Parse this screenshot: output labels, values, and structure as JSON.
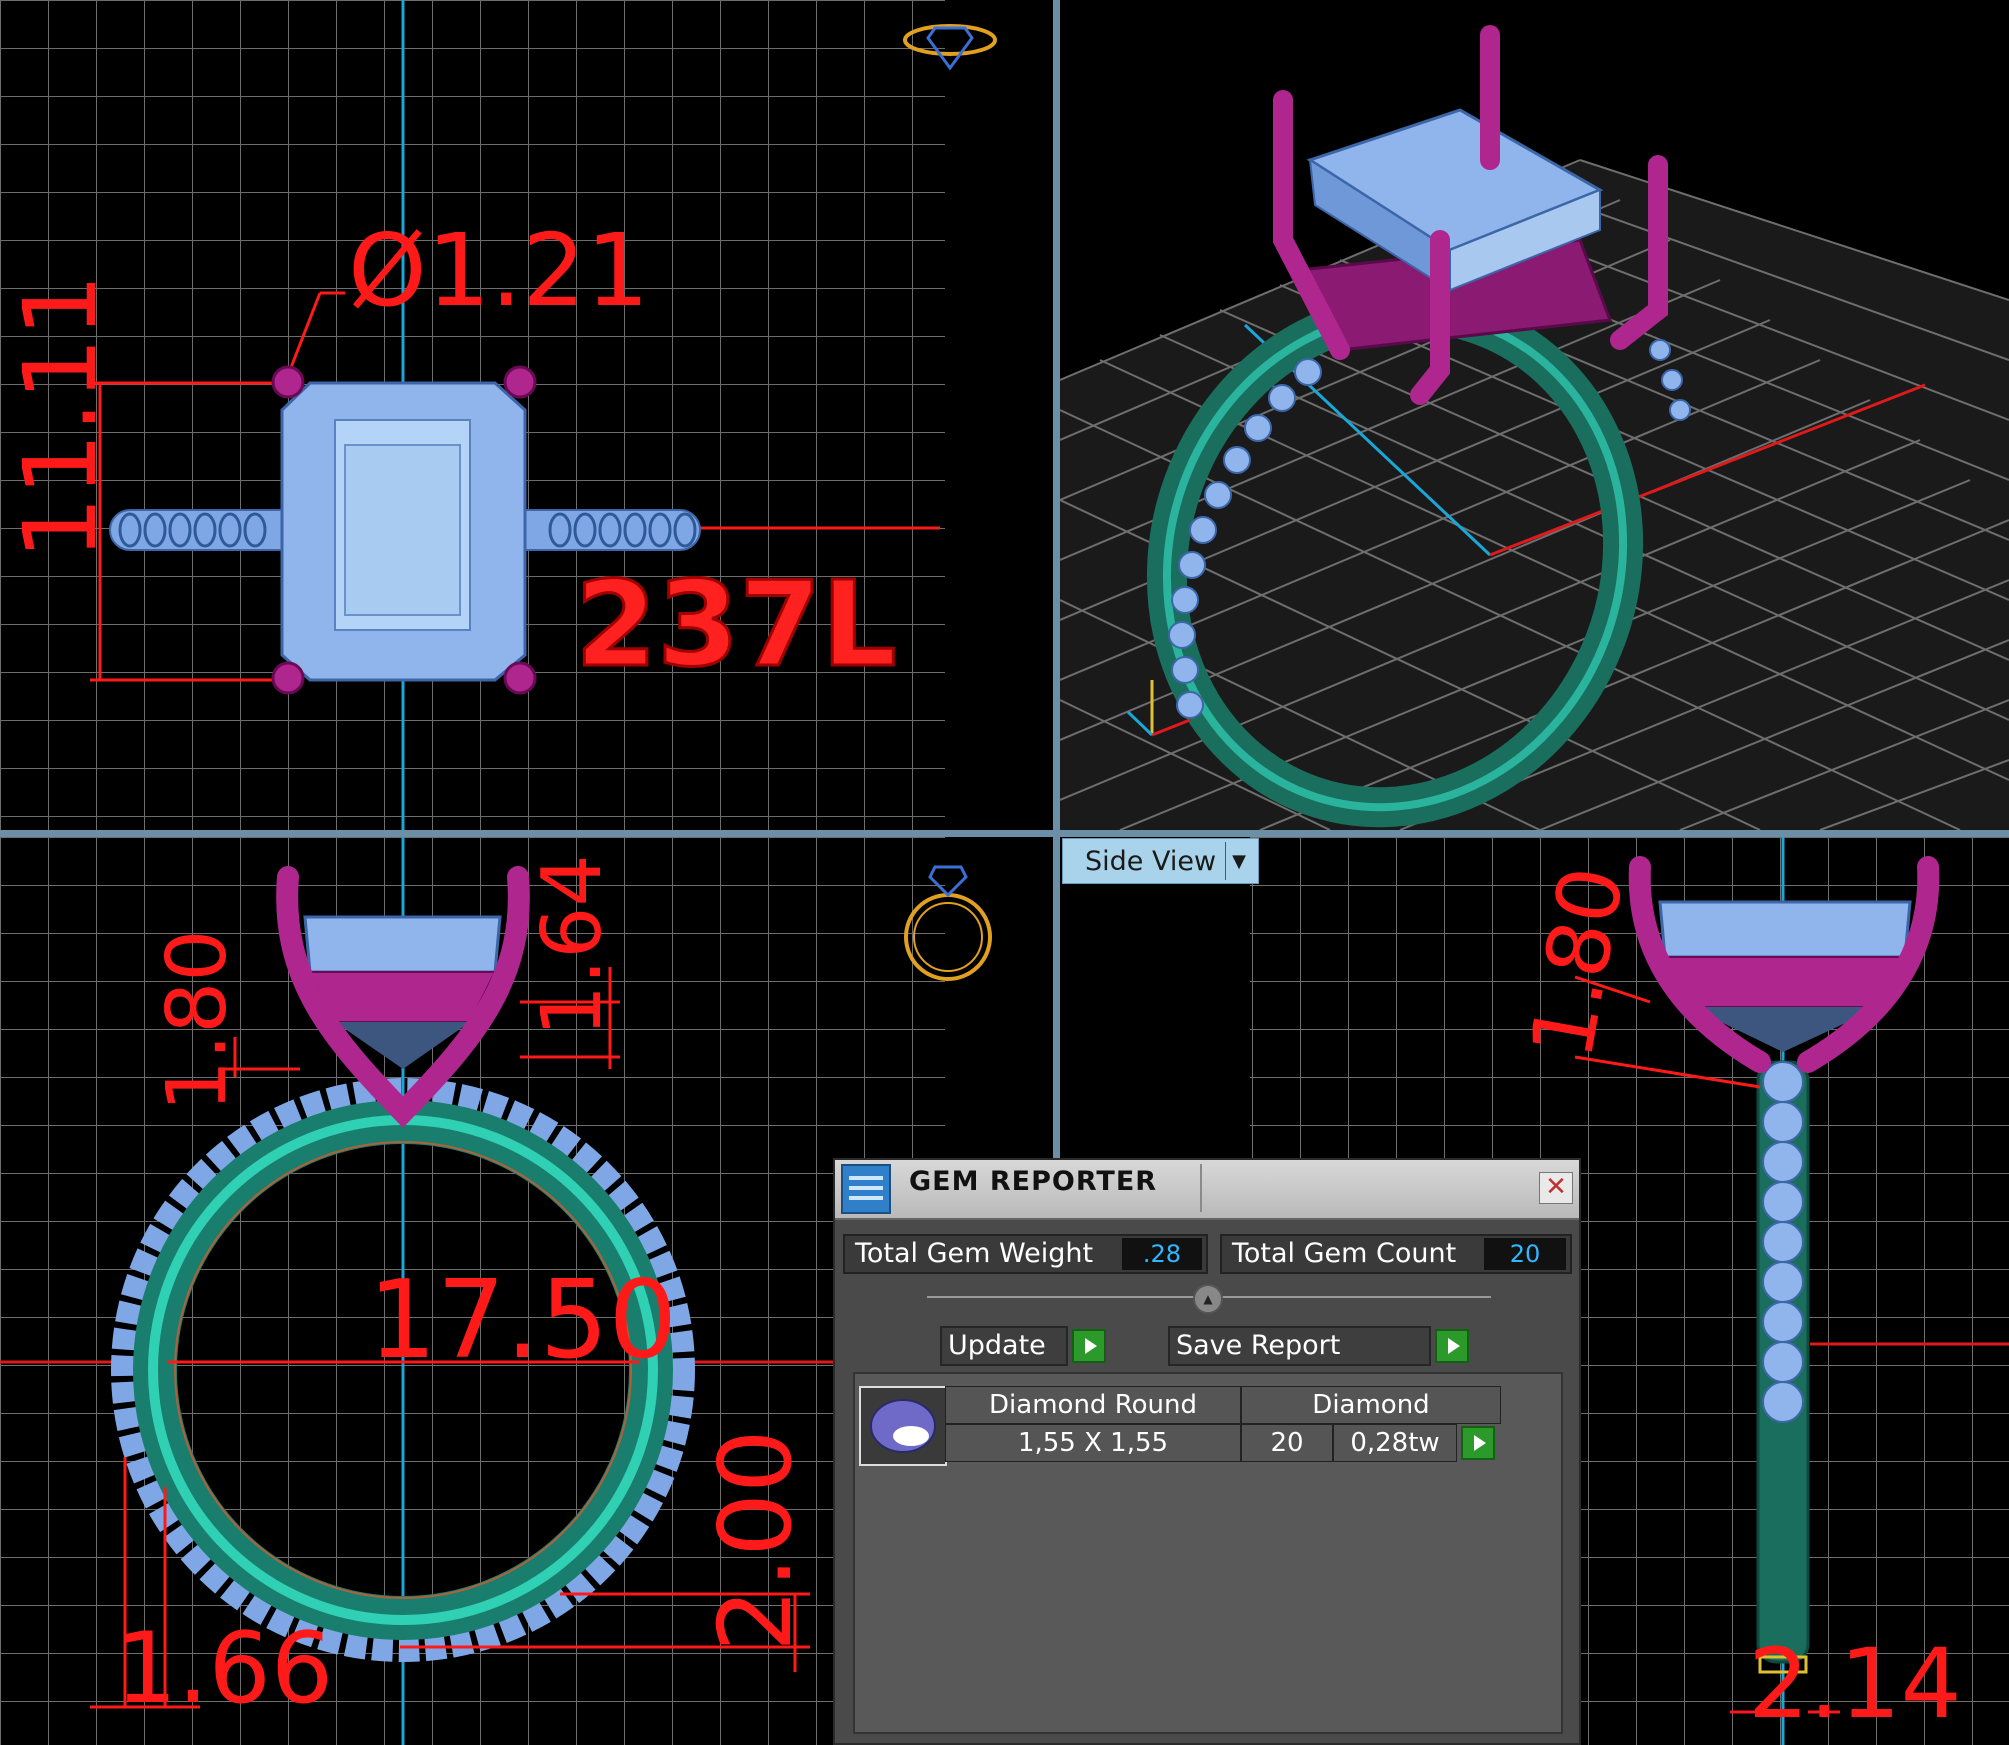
{
  "viewports": {
    "top": {
      "dimensions": {
        "diameter": "Ø1.21",
        "height": "11.11"
      },
      "label": "237L"
    },
    "front": {
      "dimensions": {
        "prong_left": "1.80",
        "prong_right": "1.64",
        "inner_diameter": "17.50",
        "band_height": "2.00",
        "band_width": "1.66"
      }
    },
    "side": {
      "view_label": "Side View",
      "dimensions": {
        "prong": "1.80",
        "band_thickness": "2.14"
      }
    }
  },
  "gem_reporter": {
    "title": "GEM REPORTER",
    "close_icon": "close-icon",
    "total_gem_weight_label": "Total Gem Weight",
    "total_gem_weight": ".28",
    "total_gem_count_label": "Total Gem Count",
    "total_gem_count": "20",
    "update_label": "Update",
    "save_report_label": "Save Report",
    "gems": [
      {
        "name": "Diamond Round",
        "size": "1,55 X 1,55",
        "material": "Diamond",
        "count": "20",
        "weight": "0,28tw"
      }
    ]
  },
  "colors": {
    "dimension": "#ff1a1a",
    "gem": "#7fa7e6",
    "prong": "#b0268f",
    "band": "#1f9e8a",
    "grid": "#6e6e6e",
    "axis_blue": "#1aa6d6",
    "axis_red": "#e01a1a"
  }
}
